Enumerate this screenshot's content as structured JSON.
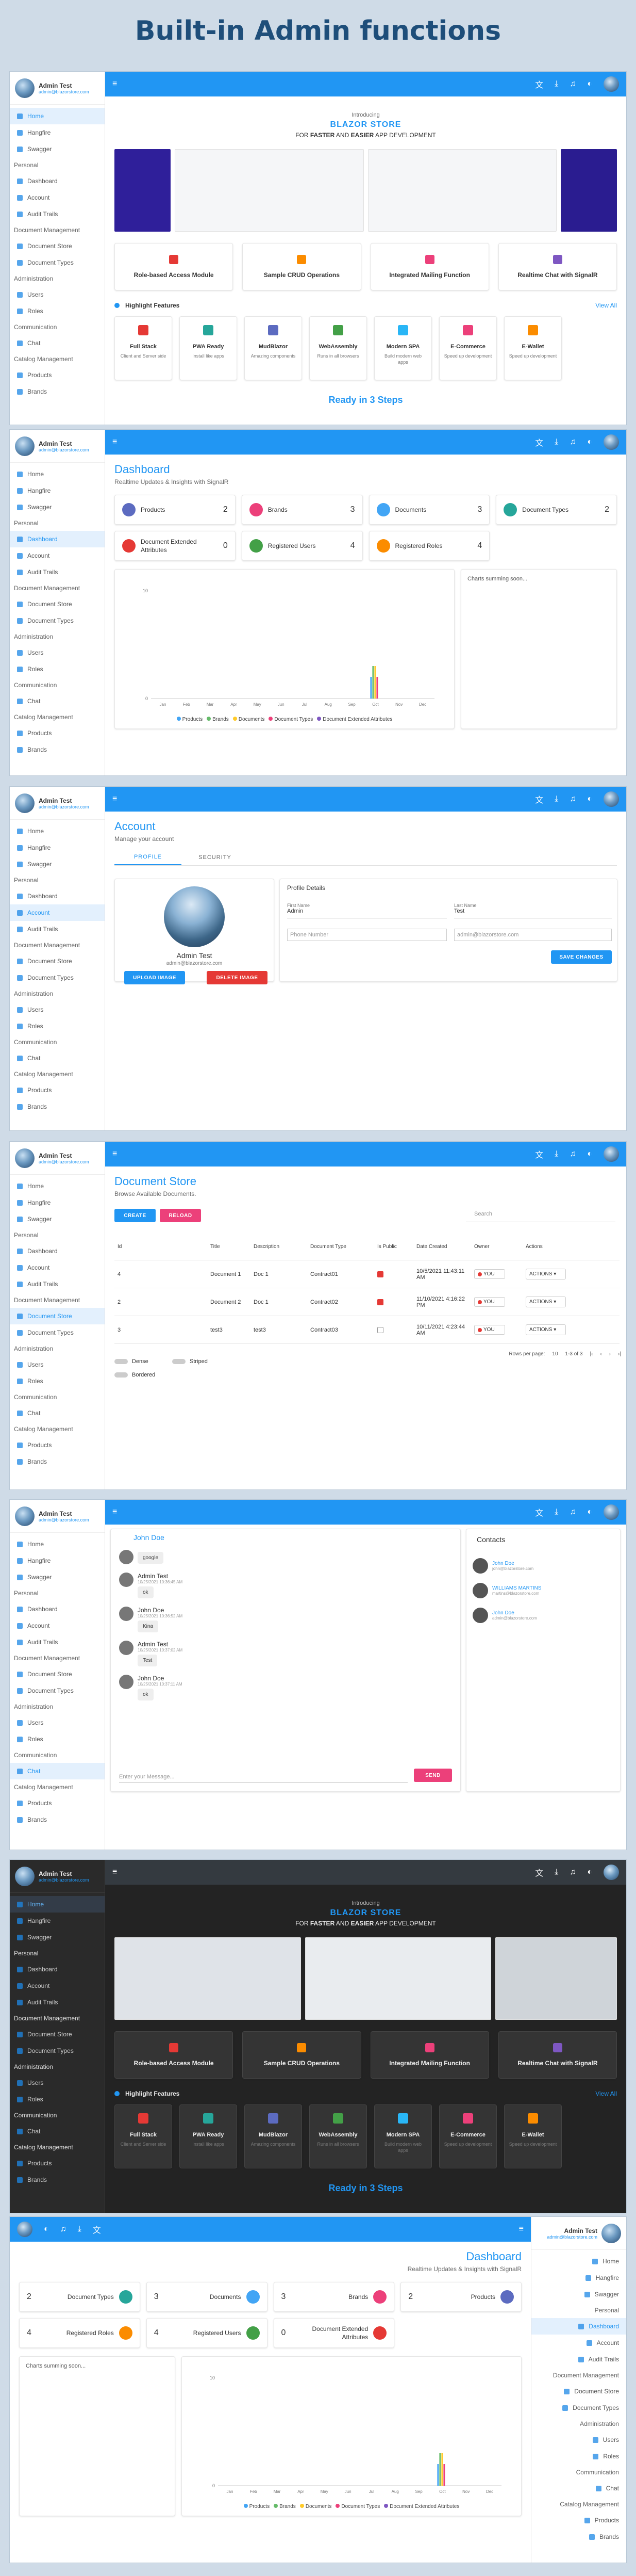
{
  "page_title": "Built-in Admin functions",
  "user": {
    "name": "Admin Test",
    "email": "admin@blazorstore.com"
  },
  "nav": [
    {
      "label": "Home",
      "section": false
    },
    {
      "label": "Hangfire",
      "section": false
    },
    {
      "label": "Swagger",
      "section": false
    },
    {
      "label": "Personal",
      "section": true
    },
    {
      "label": "Dashboard",
      "section": false
    },
    {
      "label": "Account",
      "section": false
    },
    {
      "label": "Audit Trails",
      "section": false
    },
    {
      "label": "Document Management",
      "section": true
    },
    {
      "label": "Document Store",
      "section": false
    },
    {
      "label": "Document Types",
      "section": false
    },
    {
      "label": "Administration",
      "section": true
    },
    {
      "label": "Users",
      "section": false
    },
    {
      "label": "Roles",
      "section": false
    },
    {
      "label": "Communication",
      "section": true
    },
    {
      "label": "Chat",
      "section": false
    },
    {
      "label": "Catalog Management",
      "section": true
    },
    {
      "label": "Products",
      "section": false
    },
    {
      "label": "Brands",
      "section": false
    }
  ],
  "home": {
    "intro": "Introducing",
    "store": "BLAZOR STORE",
    "tagline_pre": "FOR ",
    "tagline_b1": "FASTER",
    "tagline_mid": " AND ",
    "tagline_b2": "EASIER",
    "tagline_post": " APP DEVELOPMENT",
    "features": [
      {
        "label": "Role-based Access Module",
        "color": "#e53935"
      },
      {
        "label": "Sample CRUD Operations",
        "color": "#fb8c00"
      },
      {
        "label": "Integrated Mailing Function",
        "color": "#ec407a"
      },
      {
        "label": "Realtime Chat with SignalR",
        "color": "#7e57c2"
      }
    ],
    "highlight_title": "Highlight Features",
    "view_all": "View All",
    "highlights": [
      {
        "title": "Full Stack",
        "desc": "Client and Server side",
        "color": "#e53935"
      },
      {
        "title": "PWA Ready",
        "desc": "Install like apps",
        "color": "#26a69a"
      },
      {
        "title": "MudBlazor",
        "desc": "Amazing components",
        "color": "#5c6bc0"
      },
      {
        "title": "WebAssembly",
        "desc": "Runs in all browsers",
        "color": "#43a047"
      },
      {
        "title": "Modern SPA",
        "desc": "Build modern web apps",
        "color": "#29b6f6"
      },
      {
        "title": "E-Commerce",
        "desc": "Speed up development",
        "color": "#ec407a"
      },
      {
        "title": "E-Wallet",
        "desc": "Speed up development",
        "color": "#fb8c00"
      }
    ],
    "ready": "Ready in 3 Steps"
  },
  "dashboard": {
    "title": "Dashboard",
    "subtitle": "Realtime Updates & Insights with SignalR",
    "cards": [
      {
        "label": "Products",
        "value": "2",
        "color": "#5c6bc0"
      },
      {
        "label": "Brands",
        "value": "3",
        "color": "#ec407a"
      },
      {
        "label": "Documents",
        "value": "3",
        "color": "#42a5f5"
      },
      {
        "label": "Document Types",
        "value": "2",
        "color": "#26a69a"
      },
      {
        "label": "Document Extended Attributes",
        "value": "0",
        "color": "#e53935"
      },
      {
        "label": "Registered Users",
        "value": "4",
        "color": "#43a047"
      },
      {
        "label": "Registered Roles",
        "value": "4",
        "color": "#fb8c00"
      }
    ],
    "chart_status": "Charts summing soon...",
    "legend": [
      {
        "label": "Products",
        "color": "#42a5f5"
      },
      {
        "label": "Brands",
        "color": "#66bb6a"
      },
      {
        "label": "Documents",
        "color": "#ffca28"
      },
      {
        "label": "Document Types",
        "color": "#ec407a"
      },
      {
        "label": "Document Extended Attributes",
        "color": "#7e57c2"
      }
    ],
    "months": [
      "Jan",
      "Feb",
      "Mar",
      "Apr",
      "May",
      "Jun",
      "Jul",
      "Aug",
      "Sep",
      "Oct",
      "Nov",
      "Dec"
    ]
  },
  "chart_data": {
    "type": "bar",
    "categories": [
      "Jan",
      "Feb",
      "Mar",
      "Apr",
      "May",
      "Jun",
      "Jul",
      "Aug",
      "Sep",
      "Oct",
      "Nov",
      "Dec"
    ],
    "ylim": [
      0,
      10
    ],
    "series": [
      {
        "name": "Products",
        "values": [
          0,
          0,
          0,
          0,
          0,
          0,
          0,
          0,
          0,
          2,
          0,
          0
        ]
      },
      {
        "name": "Brands",
        "values": [
          0,
          0,
          0,
          0,
          0,
          0,
          0,
          0,
          0,
          3,
          0,
          0
        ]
      },
      {
        "name": "Documents",
        "values": [
          0,
          0,
          0,
          0,
          0,
          0,
          0,
          0,
          0,
          3,
          0,
          0
        ]
      },
      {
        "name": "Document Types",
        "values": [
          0,
          0,
          0,
          0,
          0,
          0,
          0,
          0,
          0,
          2,
          0,
          0
        ]
      },
      {
        "name": "Document Extended Attributes",
        "values": [
          0,
          0,
          0,
          0,
          0,
          0,
          0,
          0,
          0,
          0,
          0,
          0
        ]
      }
    ]
  },
  "account": {
    "title": "Account",
    "subtitle": "Manage your account",
    "tab_profile": "PROFILE",
    "tab_security": "SECURITY",
    "upload": "UPLOAD IMAGE",
    "delete": "DELETE IMAGE",
    "details_title": "Profile Details",
    "first_label": "First Name",
    "first_value": "Admin",
    "last_label": "Last Name",
    "last_value": "Test",
    "phone_placeholder": "Phone Number",
    "email_value": "admin@blazorstore.com",
    "save": "SAVE CHANGES"
  },
  "docs": {
    "title": "Document Store",
    "subtitle": "Browse Available Documents.",
    "create": "CREATE",
    "reload": "RELOAD",
    "search_placeholder": "Search",
    "headers": [
      "Id",
      "Title",
      "Description",
      "Document Type",
      "Is Public",
      "Date Created",
      "Owner",
      "Actions"
    ],
    "rows": [
      {
        "id": "4",
        "title": "Document 1",
        "desc": "Doc 1",
        "type": "Contract01",
        "public": true,
        "date": "10/5/2021 11:43:11 AM",
        "owner": "YOU",
        "action": "ACTIONS"
      },
      {
        "id": "2",
        "title": "Document 2",
        "desc": "Doc 1",
        "type": "Contract02",
        "public": true,
        "date": "11/10/2021 4:16:22 PM",
        "owner": "YOU",
        "action": "ACTIONS"
      },
      {
        "id": "3",
        "title": "test3",
        "desc": "test3",
        "type": "Contract03",
        "public": false,
        "date": "10/11/2021 4:23:44 AM",
        "owner": "YOU",
        "action": "ACTIONS"
      }
    ],
    "dense": "Dense",
    "striped": "Striped",
    "bordered": "Bordered",
    "rows_per_page": "Rows per page:",
    "rows_count": "10",
    "range": "1-3 of 3"
  },
  "chat": {
    "partner": "John Doe",
    "messages": [
      {
        "name": "",
        "time": "",
        "text": "google"
      },
      {
        "name": "Admin Test",
        "time": "10/25/2021 10:36:45 AM",
        "text": "ok"
      },
      {
        "name": "John Doe",
        "time": "10/25/2021 10:36:52 AM",
        "text": "Kina"
      },
      {
        "name": "Admin Test",
        "time": "10/25/2021 10:37:02 AM",
        "text": "Test"
      },
      {
        "name": "John Doe",
        "time": "10/25/2021 10:37:11 AM",
        "text": "ok"
      }
    ],
    "input_placeholder": "Enter your Message...",
    "send": "SEND",
    "contacts_title": "Contacts",
    "contacts": [
      {
        "name": "John Doe",
        "mail": "john@blazorstore.com"
      },
      {
        "name": "WILLIAMS MARTINS",
        "mail": "martins@blazorstore.com"
      },
      {
        "name": "John Doe",
        "mail": "admin@blazorstore.com"
      }
    ]
  }
}
